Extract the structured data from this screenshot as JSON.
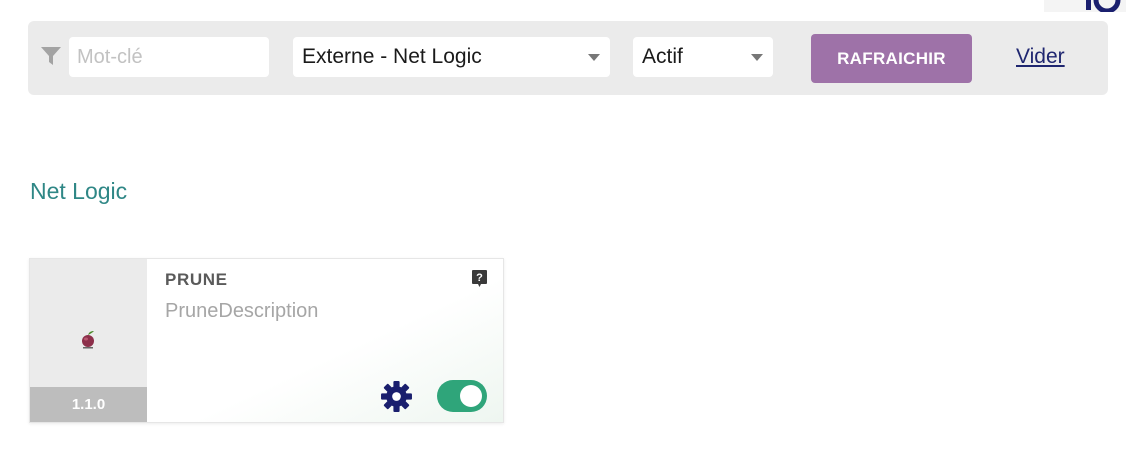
{
  "filter_bar": {
    "keyword_placeholder": "Mot-clé",
    "keyword_value": "",
    "source_select": {
      "value": "Externe - Net Logic"
    },
    "status_select": {
      "value": "Actif"
    },
    "refresh_label": "RAFRAICHIR",
    "clear_label": "Vider"
  },
  "section": {
    "title": "Net Logic"
  },
  "module": {
    "name": "PRUNE",
    "description": "PruneDescription",
    "version": "1.1.0",
    "enabled": true,
    "icons": {
      "thumbnail": "plum-icon",
      "help": "help-icon",
      "settings": "gear-icon",
      "toggle": "toggle-switch"
    }
  },
  "colors": {
    "accent_button": "#9e72a8",
    "section_title": "#2f8786",
    "toggle_on": "#2fa57a",
    "settings_icon": "#1a1f6e",
    "link": "#1f2670"
  }
}
